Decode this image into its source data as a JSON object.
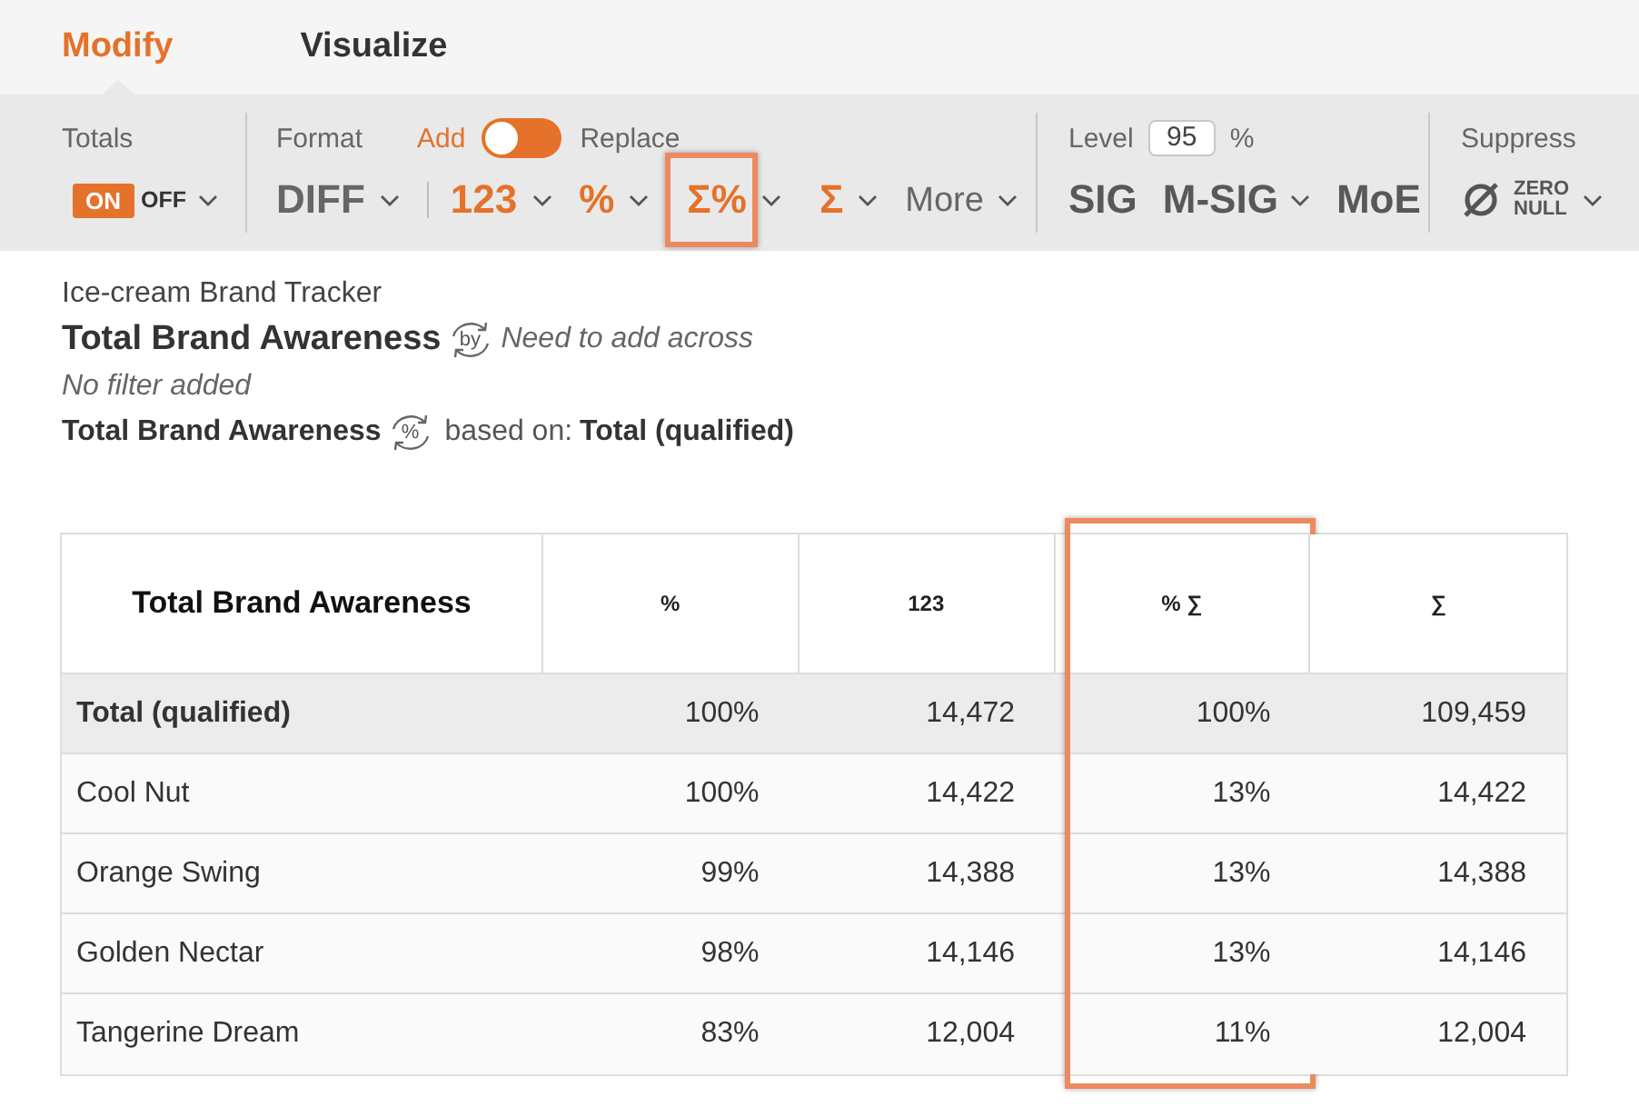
{
  "tabs": [
    {
      "label": "Modify",
      "selected": true
    },
    {
      "label": "Visualize",
      "selected": false
    }
  ],
  "toolbar": {
    "totals": {
      "label": "Totals",
      "on_label": "ON",
      "off_label": "OFF",
      "on": true
    },
    "format": {
      "label": "Format",
      "add_label": "Add",
      "replace_label": "Replace",
      "replace": false,
      "diff_button": {
        "label": "DIFF",
        "on": false,
        "dropdown": true
      },
      "buttons": [
        {
          "kind": "format",
          "label": "123",
          "on": true,
          "dropdown": true,
          "highlighted": false
        },
        {
          "kind": "format",
          "label": "%",
          "on": true,
          "dropdown": true,
          "highlighted": false
        },
        {
          "kind": "format",
          "label": "Σ%",
          "on": true,
          "dropdown": true,
          "highlighted": true
        },
        {
          "kind": "format",
          "label": "Σ",
          "on": true,
          "dropdown": true,
          "highlighted": false
        },
        {
          "kind": "menu",
          "label": "More",
          "on": false,
          "dropdown": true,
          "highlighted": false
        }
      ]
    },
    "significance": {
      "label": "Level",
      "value": "95",
      "unit": "%",
      "buttons": [
        {
          "label": "SIG",
          "dropdown": false
        },
        {
          "label": "M-SIG",
          "dropdown": true
        },
        {
          "label": "MoE",
          "dropdown": false
        }
      ]
    },
    "suppress": {
      "label": "Suppress",
      "lines": [
        "ZERO",
        "NULL"
      ],
      "dropdown": true
    }
  },
  "summary": {
    "project": "Ice-cream Brand Tracker",
    "question": "Total Brand Awareness",
    "crosstab_label": "by",
    "crosstab_hint": "Need to add across",
    "filter": "No filter added",
    "statistic_question": "Total Brand Awareness",
    "statistic_label": "%",
    "base_prefix": "based on:",
    "base": "Total (qualified)"
  },
  "table": {
    "columns": [
      {
        "label": "Total Brand Awareness",
        "highlighted": false
      },
      {
        "label": "%",
        "highlighted": false
      },
      {
        "label": "123",
        "highlighted": false
      },
      {
        "label": "% ∑",
        "highlighted": true
      },
      {
        "label": "∑",
        "highlighted": false
      }
    ],
    "rows": [
      {
        "kind": "total",
        "label": "Total (qualified)",
        "values": [
          "100%",
          "14,472",
          "100%",
          "109,459"
        ]
      },
      {
        "kind": "item",
        "label": "Cool Nut",
        "values": [
          "100%",
          "14,422",
          "13%",
          "14,422"
        ]
      },
      {
        "kind": "item",
        "label": "Orange Swing",
        "values": [
          "99%",
          "14,388",
          "13%",
          "14,388"
        ]
      },
      {
        "kind": "item",
        "label": "Golden Nectar",
        "values": [
          "98%",
          "14,146",
          "13%",
          "14,146"
        ]
      },
      {
        "kind": "item",
        "label": "Tangerine Dream",
        "values": [
          "83%",
          "12,004",
          "11%",
          "12,004"
        ]
      }
    ]
  }
}
